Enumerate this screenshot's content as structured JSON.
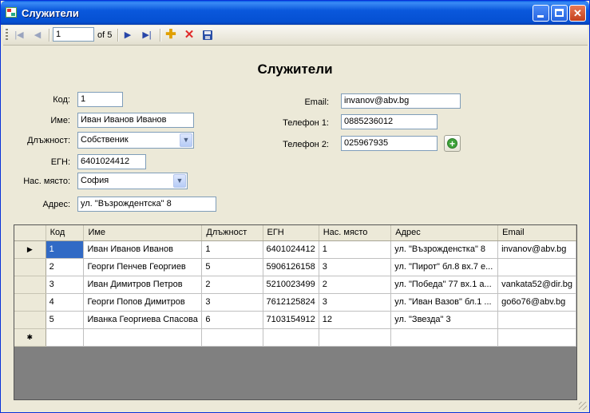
{
  "window": {
    "title": "Служители"
  },
  "navigator": {
    "position": "1",
    "count_label": "of 5"
  },
  "form": {
    "heading": "Служители",
    "fields": {
      "code": {
        "label": "Код:",
        "value": "1"
      },
      "name": {
        "label": "Име:",
        "value": "Иван Иванов Иванов"
      },
      "position": {
        "label": "Длъжност:",
        "value": "Собственик"
      },
      "egn": {
        "label": "ЕГН:",
        "value": "6401024412"
      },
      "city": {
        "label": "Нас. място:",
        "value": "София"
      },
      "address": {
        "label": "Адрес:",
        "value": "ул. \"Възрождентска\" 8"
      },
      "email": {
        "label": "Email:",
        "value": "invanov@abv.bg"
      },
      "phone1": {
        "label": "Телефон 1:",
        "value": "0885236012"
      },
      "phone2": {
        "label": "Телефон 2:",
        "value": "025967935"
      }
    }
  },
  "grid": {
    "columns": [
      "Код",
      "Име",
      "Длъжност",
      "ЕГН",
      "Нас. място",
      "Адрес",
      "Email"
    ],
    "rows": [
      [
        "1",
        "Иван Иванов Иванов",
        "1",
        "6401024412",
        "1",
        "ул. \"Възрожденстка\" 8",
        "invanov@abv.bg"
      ],
      [
        "2",
        "Георги Пенчев Георгиев",
        "5",
        "5906126158",
        "3",
        "ул. \"Пирот\" бл.8 вх.7 е...",
        ""
      ],
      [
        "3",
        "Иван Димитров Петров",
        "2",
        "5210023499",
        "2",
        "ул. \"Победа\" 77 вх.1 а...",
        "vankata52@dir.bg"
      ],
      [
        "4",
        "Георги Попов Димитров",
        "3",
        "7612125824",
        "3",
        "ул. \"Иван Вазов\" бл.1 ...",
        "go6o76@abv.bg"
      ],
      [
        "5",
        "Иванка Георгиева Спасова",
        "6",
        "7103154912",
        "12",
        "ул. \"Звезда\" 3",
        ""
      ]
    ],
    "current_row_marker": "▶",
    "new_row_marker": "✱"
  }
}
